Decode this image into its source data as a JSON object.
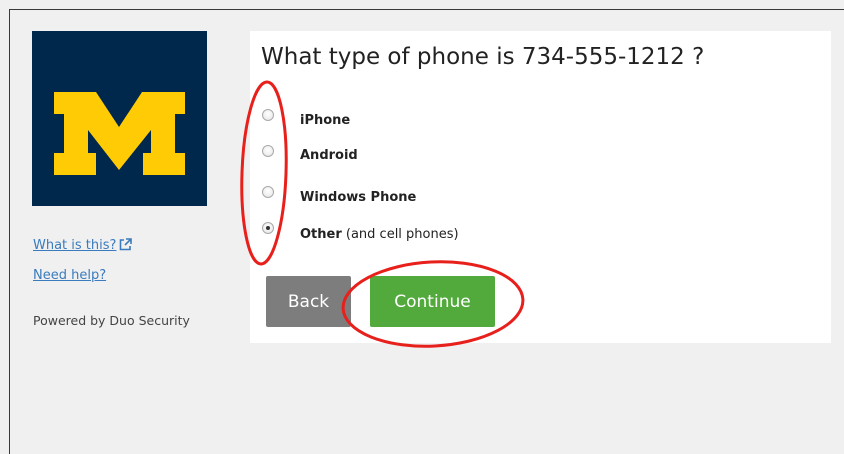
{
  "brand": {
    "logo_letter": "M",
    "colors": {
      "navy": "#00274c",
      "maize": "#ffcb05"
    }
  },
  "sidebar": {
    "what_is_this": "What is this?",
    "need_help": "Need help?",
    "powered_by": "Powered by Duo Security"
  },
  "main": {
    "question": "What type of phone is 734-555-1212 ?",
    "options": [
      {
        "label": "iPhone",
        "note": "",
        "checked": false
      },
      {
        "label": "Android",
        "note": "",
        "checked": false
      },
      {
        "label": "Windows Phone",
        "note": "",
        "checked": false
      },
      {
        "label": "Other",
        "note": " (and cell phones)",
        "checked": true
      }
    ],
    "back_label": "Back",
    "continue_label": "Continue"
  },
  "colors": {
    "link": "#3a7bbd",
    "back_button": "#7d7d7d",
    "continue_button": "#52aa3c",
    "annotation": "#e8201c"
  },
  "icons": {
    "external_link": "external-link-icon"
  }
}
